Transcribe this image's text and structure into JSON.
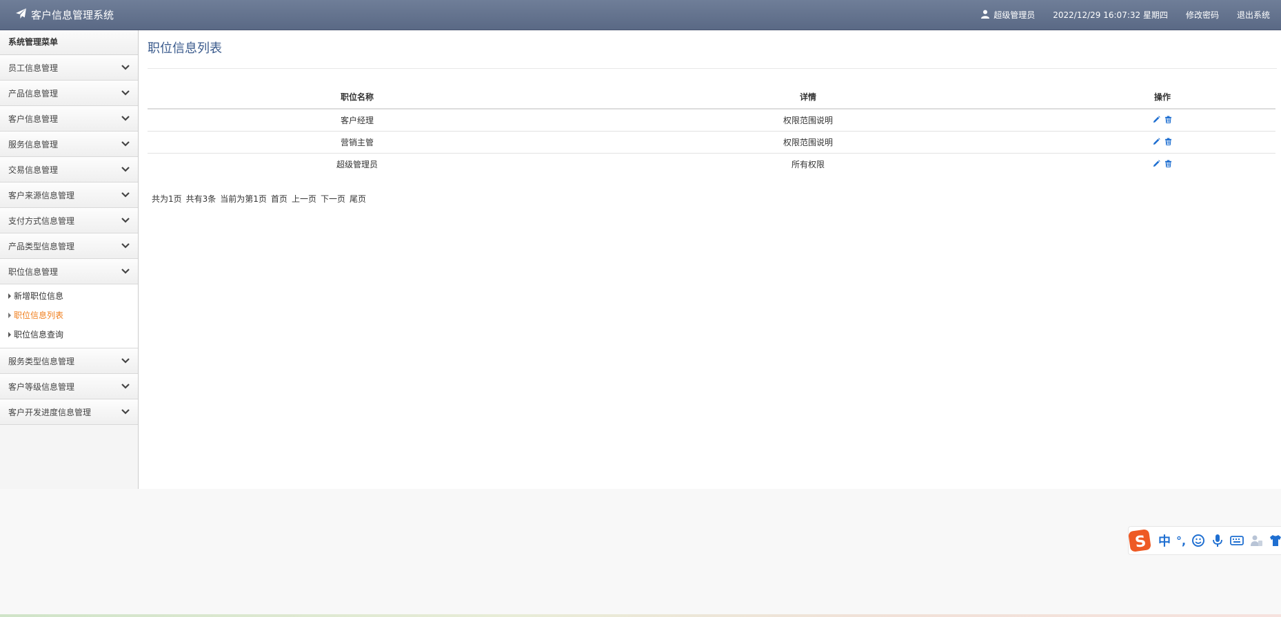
{
  "header": {
    "app_title": "客户信息管理系统",
    "user": "超级管理员",
    "datetime": "2022/12/29 16:07:32 星期四",
    "change_password": "修改密码",
    "logout": "退出系统"
  },
  "sidebar": {
    "title": "系统管理菜单",
    "items": [
      {
        "label": "员工信息管理"
      },
      {
        "label": "产品信息管理"
      },
      {
        "label": "客户信息管理"
      },
      {
        "label": "服务信息管理"
      },
      {
        "label": "交易信息管理"
      },
      {
        "label": "客户来源信息管理"
      },
      {
        "label": "支付方式信息管理"
      },
      {
        "label": "产品类型信息管理"
      },
      {
        "label": "职位信息管理"
      },
      {
        "label": "服务类型信息管理"
      },
      {
        "label": "客户等级信息管理"
      },
      {
        "label": "客户开发进度信息管理"
      }
    ],
    "expanded_submenu": [
      {
        "label": "新增职位信息",
        "active": false
      },
      {
        "label": "职位信息列表",
        "active": true
      },
      {
        "label": "职位信息查询",
        "active": false
      }
    ]
  },
  "main": {
    "title": "职位信息列表",
    "columns": [
      "职位名称",
      "详情",
      "操作"
    ],
    "rows": [
      {
        "name": "客户经理",
        "detail": "权限范围说明"
      },
      {
        "name": "营销主管",
        "detail": "权限范围说明"
      },
      {
        "name": "超级管理员",
        "detail": "所有权限"
      }
    ],
    "pager": {
      "total_pages": "共为1页",
      "total_records": "共有3条",
      "current": "当前为第1页",
      "first": "首页",
      "prev": "上一页",
      "next": "下一页",
      "last": "尾页"
    }
  },
  "ime": {
    "mode": "中",
    "punct": "°,"
  },
  "colors": {
    "header_bg": "#5f6e8a",
    "active_menu": "#f07f1e",
    "icon_blue": "#1f6fd1",
    "title_blue": "#3a5a8c"
  }
}
